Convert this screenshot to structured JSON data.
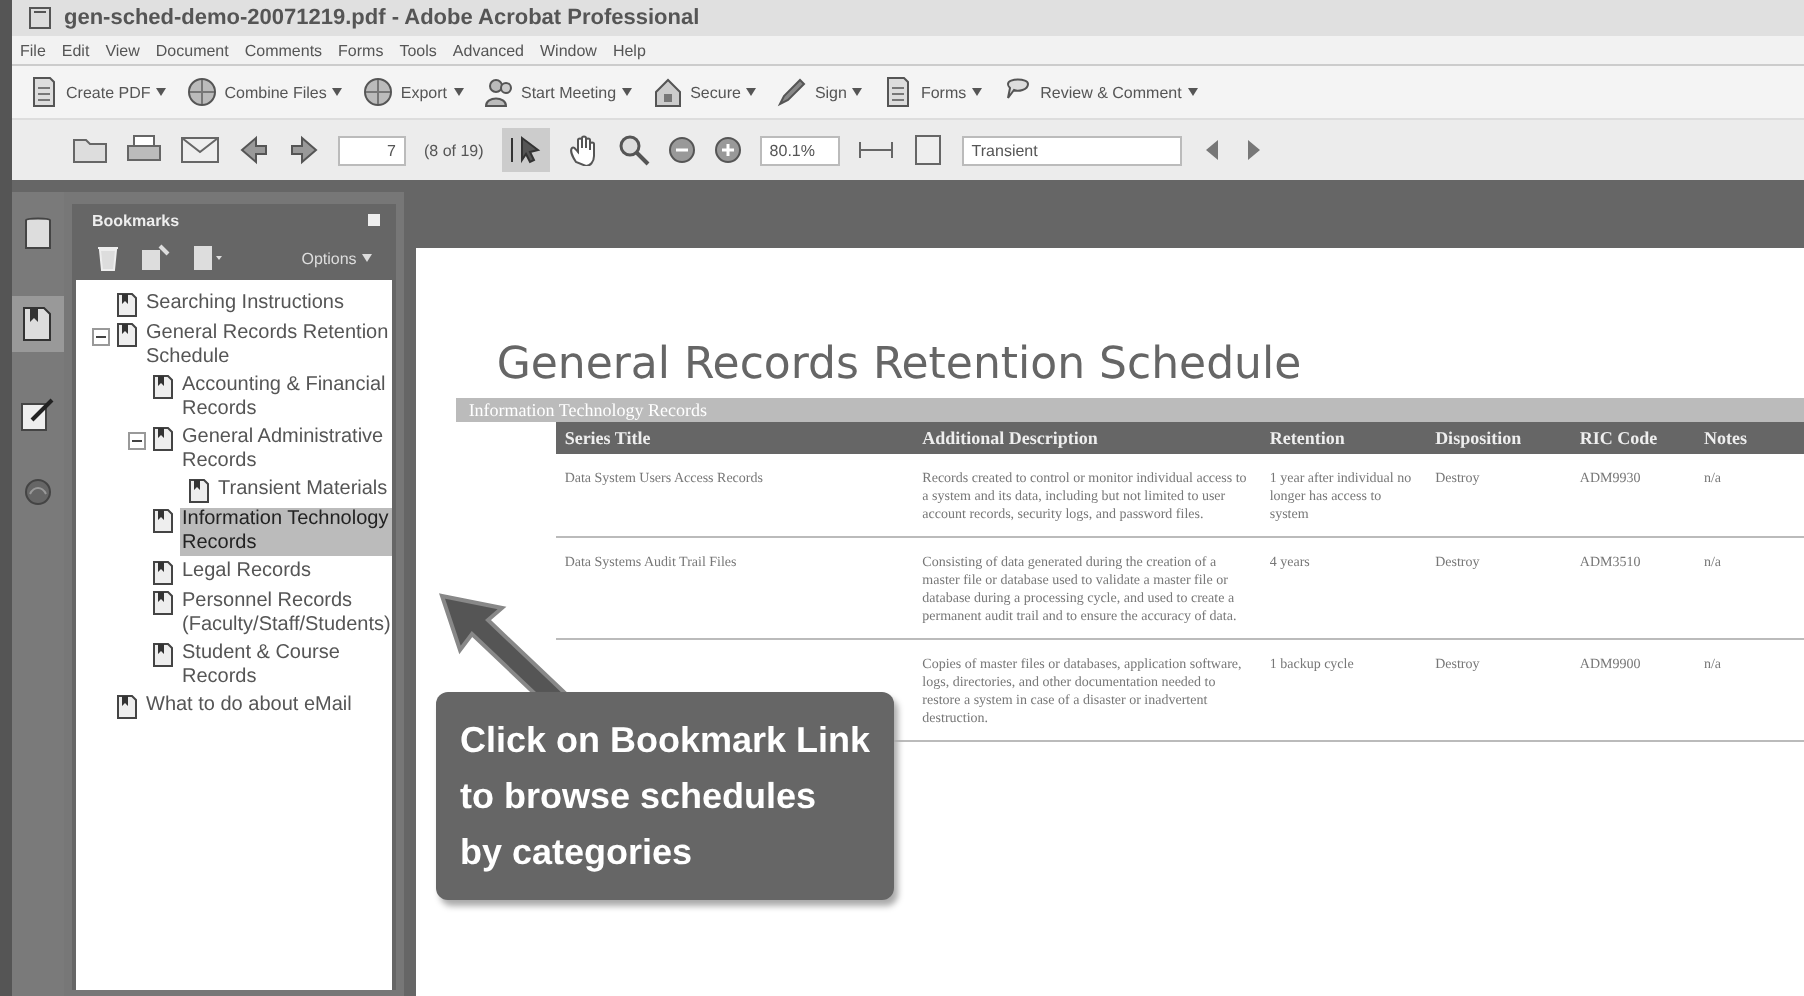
{
  "window": {
    "title": "gen-sched-demo-20071219.pdf - Adobe Acrobat Professional"
  },
  "menu_bar": [
    "File",
    "Edit",
    "View",
    "Document",
    "Comments",
    "Forms",
    "Tools",
    "Advanced",
    "Window",
    "Help"
  ],
  "task_toolbar": [
    {
      "label": "Create PDF",
      "kind": "create"
    },
    {
      "label": "Combine Files",
      "kind": "combine"
    },
    {
      "label": "Export",
      "kind": "export"
    },
    {
      "label": "Start Meeting",
      "kind": "meeting"
    },
    {
      "label": "Secure",
      "kind": "secure"
    },
    {
      "label": "Sign",
      "kind": "sign"
    },
    {
      "label": "Forms",
      "kind": "forms"
    },
    {
      "label": "Review & Comment",
      "kind": "review"
    }
  ],
  "nav_toolbar": {
    "page_field": "7",
    "page_count": "(8 of 19)",
    "zoom": "80.1%",
    "search_field": "Transient"
  },
  "bookmarks_panel": {
    "title": "Bookmarks",
    "options": "Options",
    "items": [
      {
        "label": "Searching Instructions",
        "selected": false
      },
      {
        "label": "General Records Retention Schedule",
        "selected": false,
        "expanded": true,
        "children": [
          {
            "label": "Accounting & Financial Records",
            "selected": false
          },
          {
            "label": "General Administrative Records",
            "selected": false,
            "expanded": true,
            "children": [
              {
                "label": "Transient Materials",
                "selected": false
              }
            ]
          },
          {
            "label": "Information Technology Records",
            "selected": true
          },
          {
            "label": "Legal Records",
            "selected": false
          },
          {
            "label": "Personnel Records (Faculty/Staff/Students)",
            "selected": false
          },
          {
            "label": "Student & Course Records",
            "selected": false
          }
        ]
      },
      {
        "label": "What to do about eMail",
        "selected": false
      }
    ]
  },
  "document": {
    "heading": "General Records Retention Schedule",
    "section": "Information Technology Records",
    "table": {
      "columns": [
        "Series Title",
        "Additional Description",
        "Retention",
        "Disposition",
        "RIC Code",
        "Notes"
      ],
      "rows": [
        {
          "series_title": "Data System Users Access Records",
          "description": "Records created to control or monitor individual access to a system and its data, including but not limited to user account records, security logs, and password files.",
          "retention": "1 year after individual no longer has access to system",
          "disposition": "Destroy",
          "code": "ADM9930",
          "notes": "n/a"
        },
        {
          "series_title": "Data Systems Audit Trail Files",
          "description": "Consisting of data generated during the creation of a master file or database used to validate a master file or database during a processing cycle, and used to create a permanent audit trail and to ensure the accuracy of data.",
          "retention": "4 years",
          "disposition": "Destroy",
          "code": "ADM3510",
          "notes": "n/a"
        },
        {
          "description": "Copies of master files or databases, application software, logs, directories, and other documentation needed to restore a system in case of a disaster or inadvertent destruction.",
          "retention": "1 backup cycle",
          "disposition": "Destroy",
          "code": "ADM9900",
          "notes": "n/a"
        }
      ]
    }
  },
  "callout": {
    "lines": [
      "Click on Bookmark Link",
      "to browse schedules",
      "by categories"
    ]
  }
}
